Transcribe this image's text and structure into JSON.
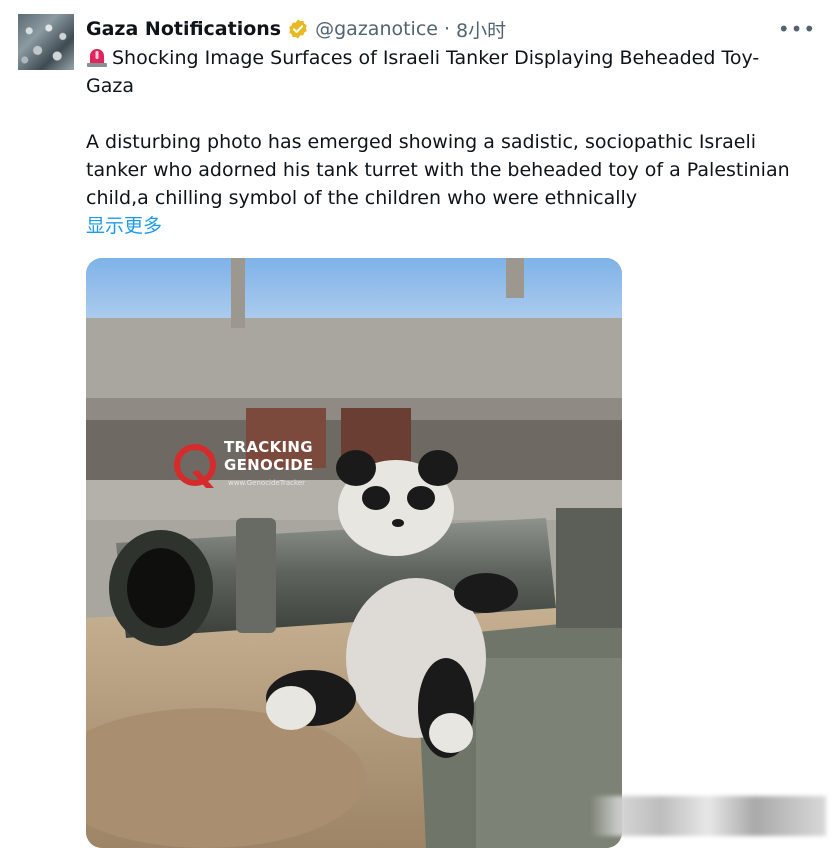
{
  "author": {
    "name": "Gaza Notifications",
    "handle": "@gazanotice",
    "separator": "·",
    "time": "8小时"
  },
  "menu": {
    "more_label": "•••"
  },
  "post": {
    "title": "Shocking Image Surfaces of Israeli Tanker Displaying Beheaded Toy-Gaza",
    "body": "A disturbing photo has emerged showing a sadistic, sociopathic Israeli tanker who adorned his tank turret with the beheaded toy of a Palestinian child,a chilling symbol of the children who were ethnically",
    "show_more": "显示更多"
  },
  "media": {
    "watermark_line1": "TRACKING",
    "watermark_line2": "GENOCIDE",
    "watermark_sub": "www.GenocideTracker"
  },
  "icons": {
    "verified": "verified-badge-icon",
    "siren": "siren-emoji-icon",
    "more": "more-options-icon"
  },
  "colors": {
    "text": "#0f1419",
    "secondary": "#536471",
    "link": "#1d9bf0",
    "verified": "#e8b923"
  }
}
